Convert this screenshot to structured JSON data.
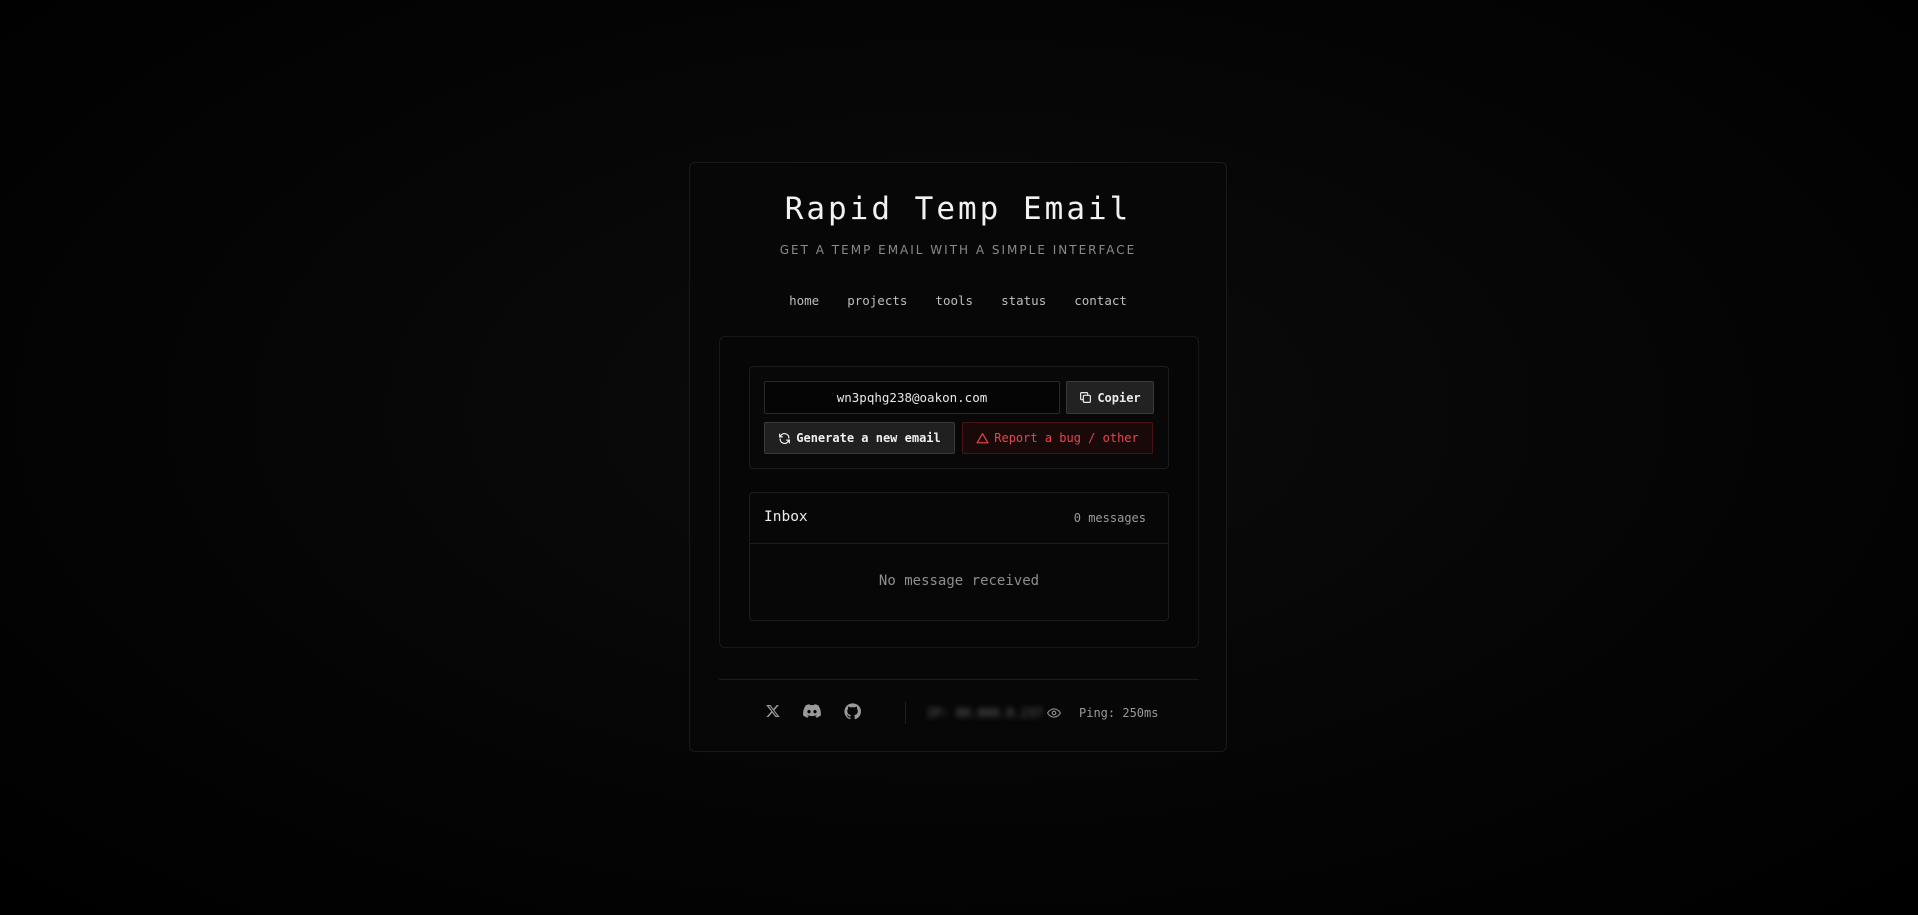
{
  "header": {
    "title": "Rapid Temp Email",
    "subtitle": "GET A TEMP EMAIL WITH A SIMPLE INTERFACE"
  },
  "nav": {
    "items": [
      {
        "label": "home"
      },
      {
        "label": "projects"
      },
      {
        "label": "tools"
      },
      {
        "label": "status"
      },
      {
        "label": "contact"
      }
    ]
  },
  "email": {
    "address": "wn3pqhg238@oakon.com",
    "copy_label": "Copier",
    "generate_label": "Generate a new email",
    "report_label": "Report a bug / other"
  },
  "inbox": {
    "title": "Inbox",
    "count": "0 messages",
    "empty_text": "No message received"
  },
  "footer": {
    "icons": [
      "x-twitter-icon",
      "discord-icon",
      "github-icon"
    ],
    "ip_text": "IP: 00.000.0.237",
    "ping_text": "Ping: 250ms"
  },
  "colors": {
    "background": "#000000",
    "card": "#070707",
    "accent_red": "#e5484d",
    "text": "#e8e8e8",
    "muted": "#8a8a8a"
  }
}
